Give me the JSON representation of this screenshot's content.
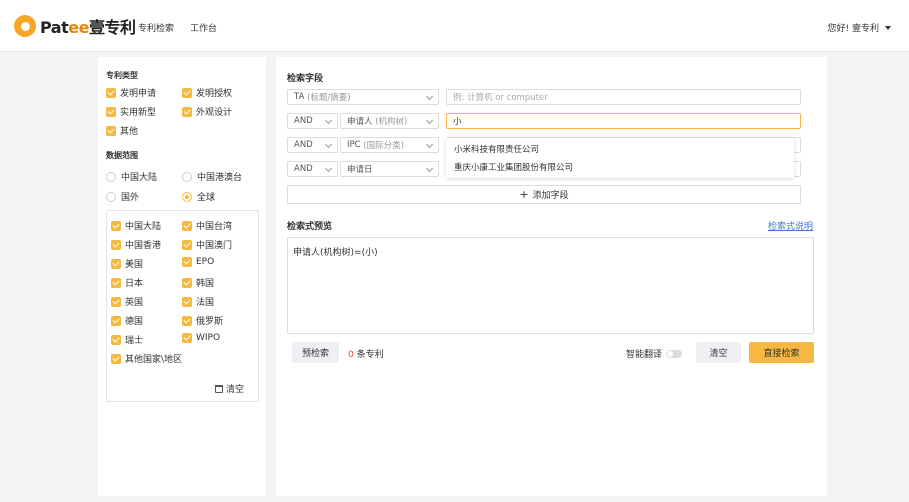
{
  "header": {
    "brand_a": "Pat",
    "brand_b": "ee",
    "brand_c": "壹专利",
    "nav": [
      "专利检索",
      "工作台"
    ],
    "user": "您好! 壹专利"
  },
  "left": {
    "patent_type_title": "专利类型",
    "patent_types": [
      "发明申请",
      "发明授权",
      "实用新型",
      "外观设计",
      "其他"
    ],
    "data_range_title": "数据范围",
    "ranges": [
      "中国大陆",
      "中国港澳台",
      "国外",
      "全球"
    ],
    "selected_range": "全球",
    "countries": [
      "中国大陆",
      "中国台湾",
      "中国香港",
      "中国澳门",
      "美国",
      "EPO",
      "日本",
      "韩国",
      "英国",
      "法国",
      "德国",
      "俄罗斯",
      "瑞士",
      "WIPO",
      "其他国家\\地区"
    ],
    "clear": "清空"
  },
  "right": {
    "search_fields_title": "检索字段",
    "rows": [
      {
        "field": "TA",
        "field_hint": "(标题/摘要)",
        "placeholder": "例: 计算机 or computer"
      },
      {
        "op": "AND",
        "field": "申请人",
        "field_hint": "(机构树)",
        "value": "小"
      },
      {
        "op": "AND",
        "field": "IPC",
        "field_hint": "(国际分类)"
      },
      {
        "op": "AND",
        "field": "申请日"
      }
    ],
    "suggestions": [
      "小米科技有限责任公司",
      "重庆小康工业集团股份有限公司"
    ],
    "add_field": "添加字段",
    "preview_title": "检索式预览",
    "help_link": "检索式说明",
    "preview_text": "申请人(机构树)=(小)",
    "pre_search": "预检索",
    "count_num": "0",
    "count_suffix": " 条专利",
    "translate": "智能翻译",
    "clear": "清空",
    "search": "直接检索"
  }
}
